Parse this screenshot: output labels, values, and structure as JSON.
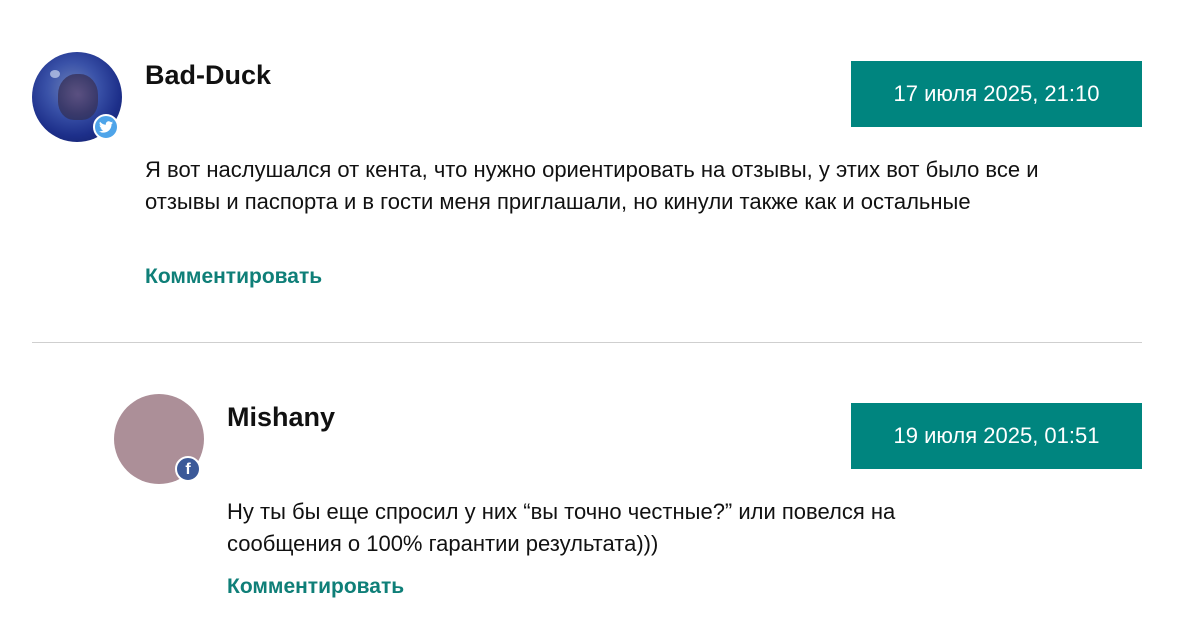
{
  "comments": [
    {
      "author": "Bad-Duck",
      "date": "17 июля 2025, 21:10",
      "text": "Я вот наслушался от кента, что нужно ориентировать на отзывы, у этих вот было все и отзывы и паспорта и в гости меня приглашали, но кинули также как и остальные",
      "reply_label": "Комментировать",
      "social": "twitter-icon"
    },
    {
      "author": "Mishany",
      "date": "19 июля 2025, 01:51",
      "text": "Ну ты бы еще спросил у них “вы точно честные?” или повелся на сообщения о 100% гарантии результата)))",
      "reply_label": "Комментировать",
      "social": "facebook-icon"
    }
  ],
  "colors": {
    "accent": "#00857f",
    "link": "#0f7f78",
    "avatar_placeholder": "#ac8f98",
    "twitter": "#4ea4e9",
    "facebook": "#3b5998",
    "divider": "#cfcfcf"
  }
}
